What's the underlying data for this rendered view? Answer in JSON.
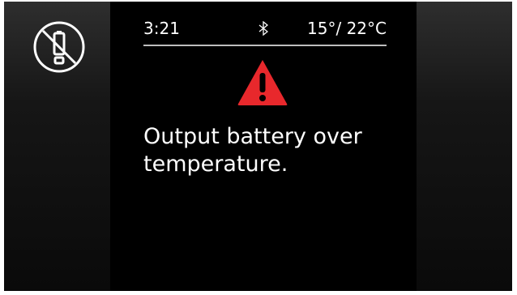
{
  "status_bar": {
    "time": "3:21",
    "temperatures": "15°/ 22°C"
  },
  "alert": {
    "message": "Output battery over temperature."
  },
  "icons": {
    "left": "no-battery-icon",
    "status": "bluetooth-icon",
    "alert": "warning-icon"
  },
  "colors": {
    "warning": "#e8282c",
    "text": "#ffffff",
    "divider": "#bdbdbd"
  }
}
